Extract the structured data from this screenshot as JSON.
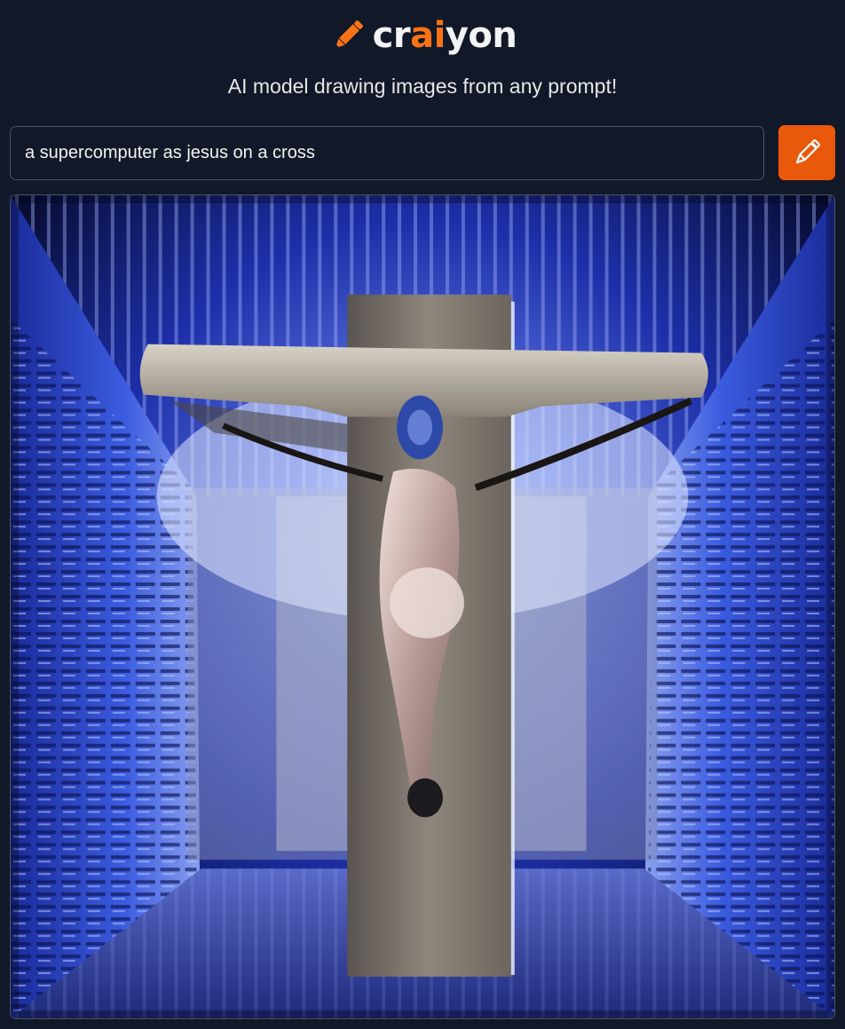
{
  "brand": {
    "logo_parts": [
      "cr",
      "ai",
      "yon"
    ],
    "accent_color": "#f97316",
    "logo_icon": "pencil-icon"
  },
  "tagline": "AI model drawing images from any prompt!",
  "prompt": {
    "value": "a supercomputer as jesus on a cross",
    "placeholder": ""
  },
  "draw_button": {
    "icon": "pencil-icon",
    "color": "#ea580c"
  },
  "generated_image": {
    "alt": "a supercomputer as jesus on a cross"
  }
}
